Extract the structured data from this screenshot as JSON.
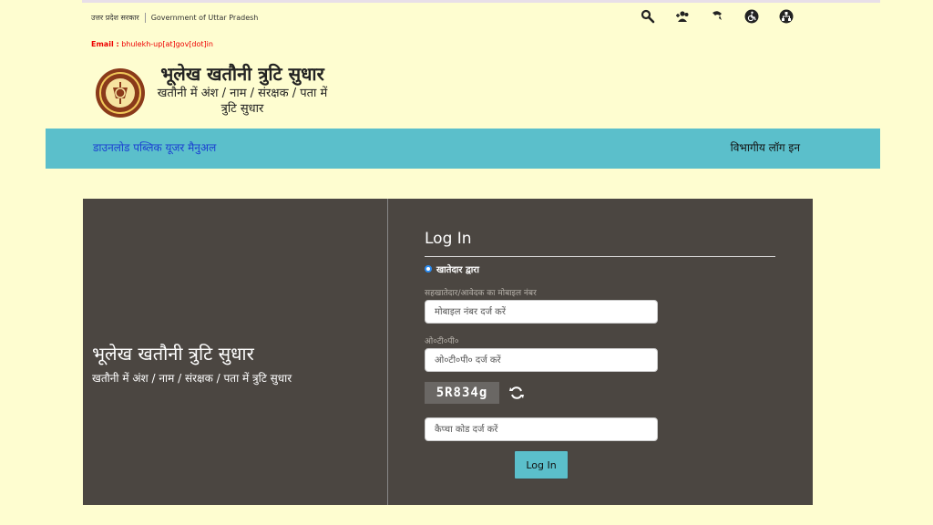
{
  "gov_bar": {
    "hindi": "उत्तर प्रदेश सरकार",
    "english": "Government of Uttar Pradesh"
  },
  "tools": {
    "search": "search-icon",
    "add_user": "add-user-icon",
    "phone": "phone-icon",
    "accessibility": "wheelchair-icon",
    "sitemap": "sitemap-icon"
  },
  "email": {
    "label": "Email :",
    "value": "bhulekh-up[at]gov[dot]in"
  },
  "site": {
    "title": "भूलेख खतौनी त्रुटि सुधार",
    "subtitle": "खतौनी में अंश / नाम / संरक्षक / पता में त्रुटि सुधार"
  },
  "nav": {
    "manual": "डाउनलोड पब्लिक यूजर मैनुअल",
    "dept_login": "विभागीय लॉग इन"
  },
  "panel": {
    "title": "भूलेख खतौनी त्रुटि सुधार",
    "subtitle": "खतौनी में अंश / नाम / संरक्षक / पता में त्रुटि सुधार"
  },
  "form": {
    "heading": "Log In",
    "radio_label": "खातेदार द्वारा",
    "mobile_label": "सहखातेदार/आवेदक का मोबाइल नंबर",
    "mobile_placeholder": "मोबाइल नंबर दर्ज करें",
    "otp_label": "ओ०टी०पी०",
    "otp_placeholder": "ओ०टी०पी० दर्ज करें",
    "captcha_text": "5R834g",
    "captcha_placeholder": "कैप्चा कोड दर्ज करें",
    "login_button": "Log In"
  },
  "colors": {
    "background": "#fefdd0",
    "nav": "#5bbfcb",
    "panel": "#4b4641",
    "email": "#ee0000",
    "link": "#1b3fd1"
  }
}
